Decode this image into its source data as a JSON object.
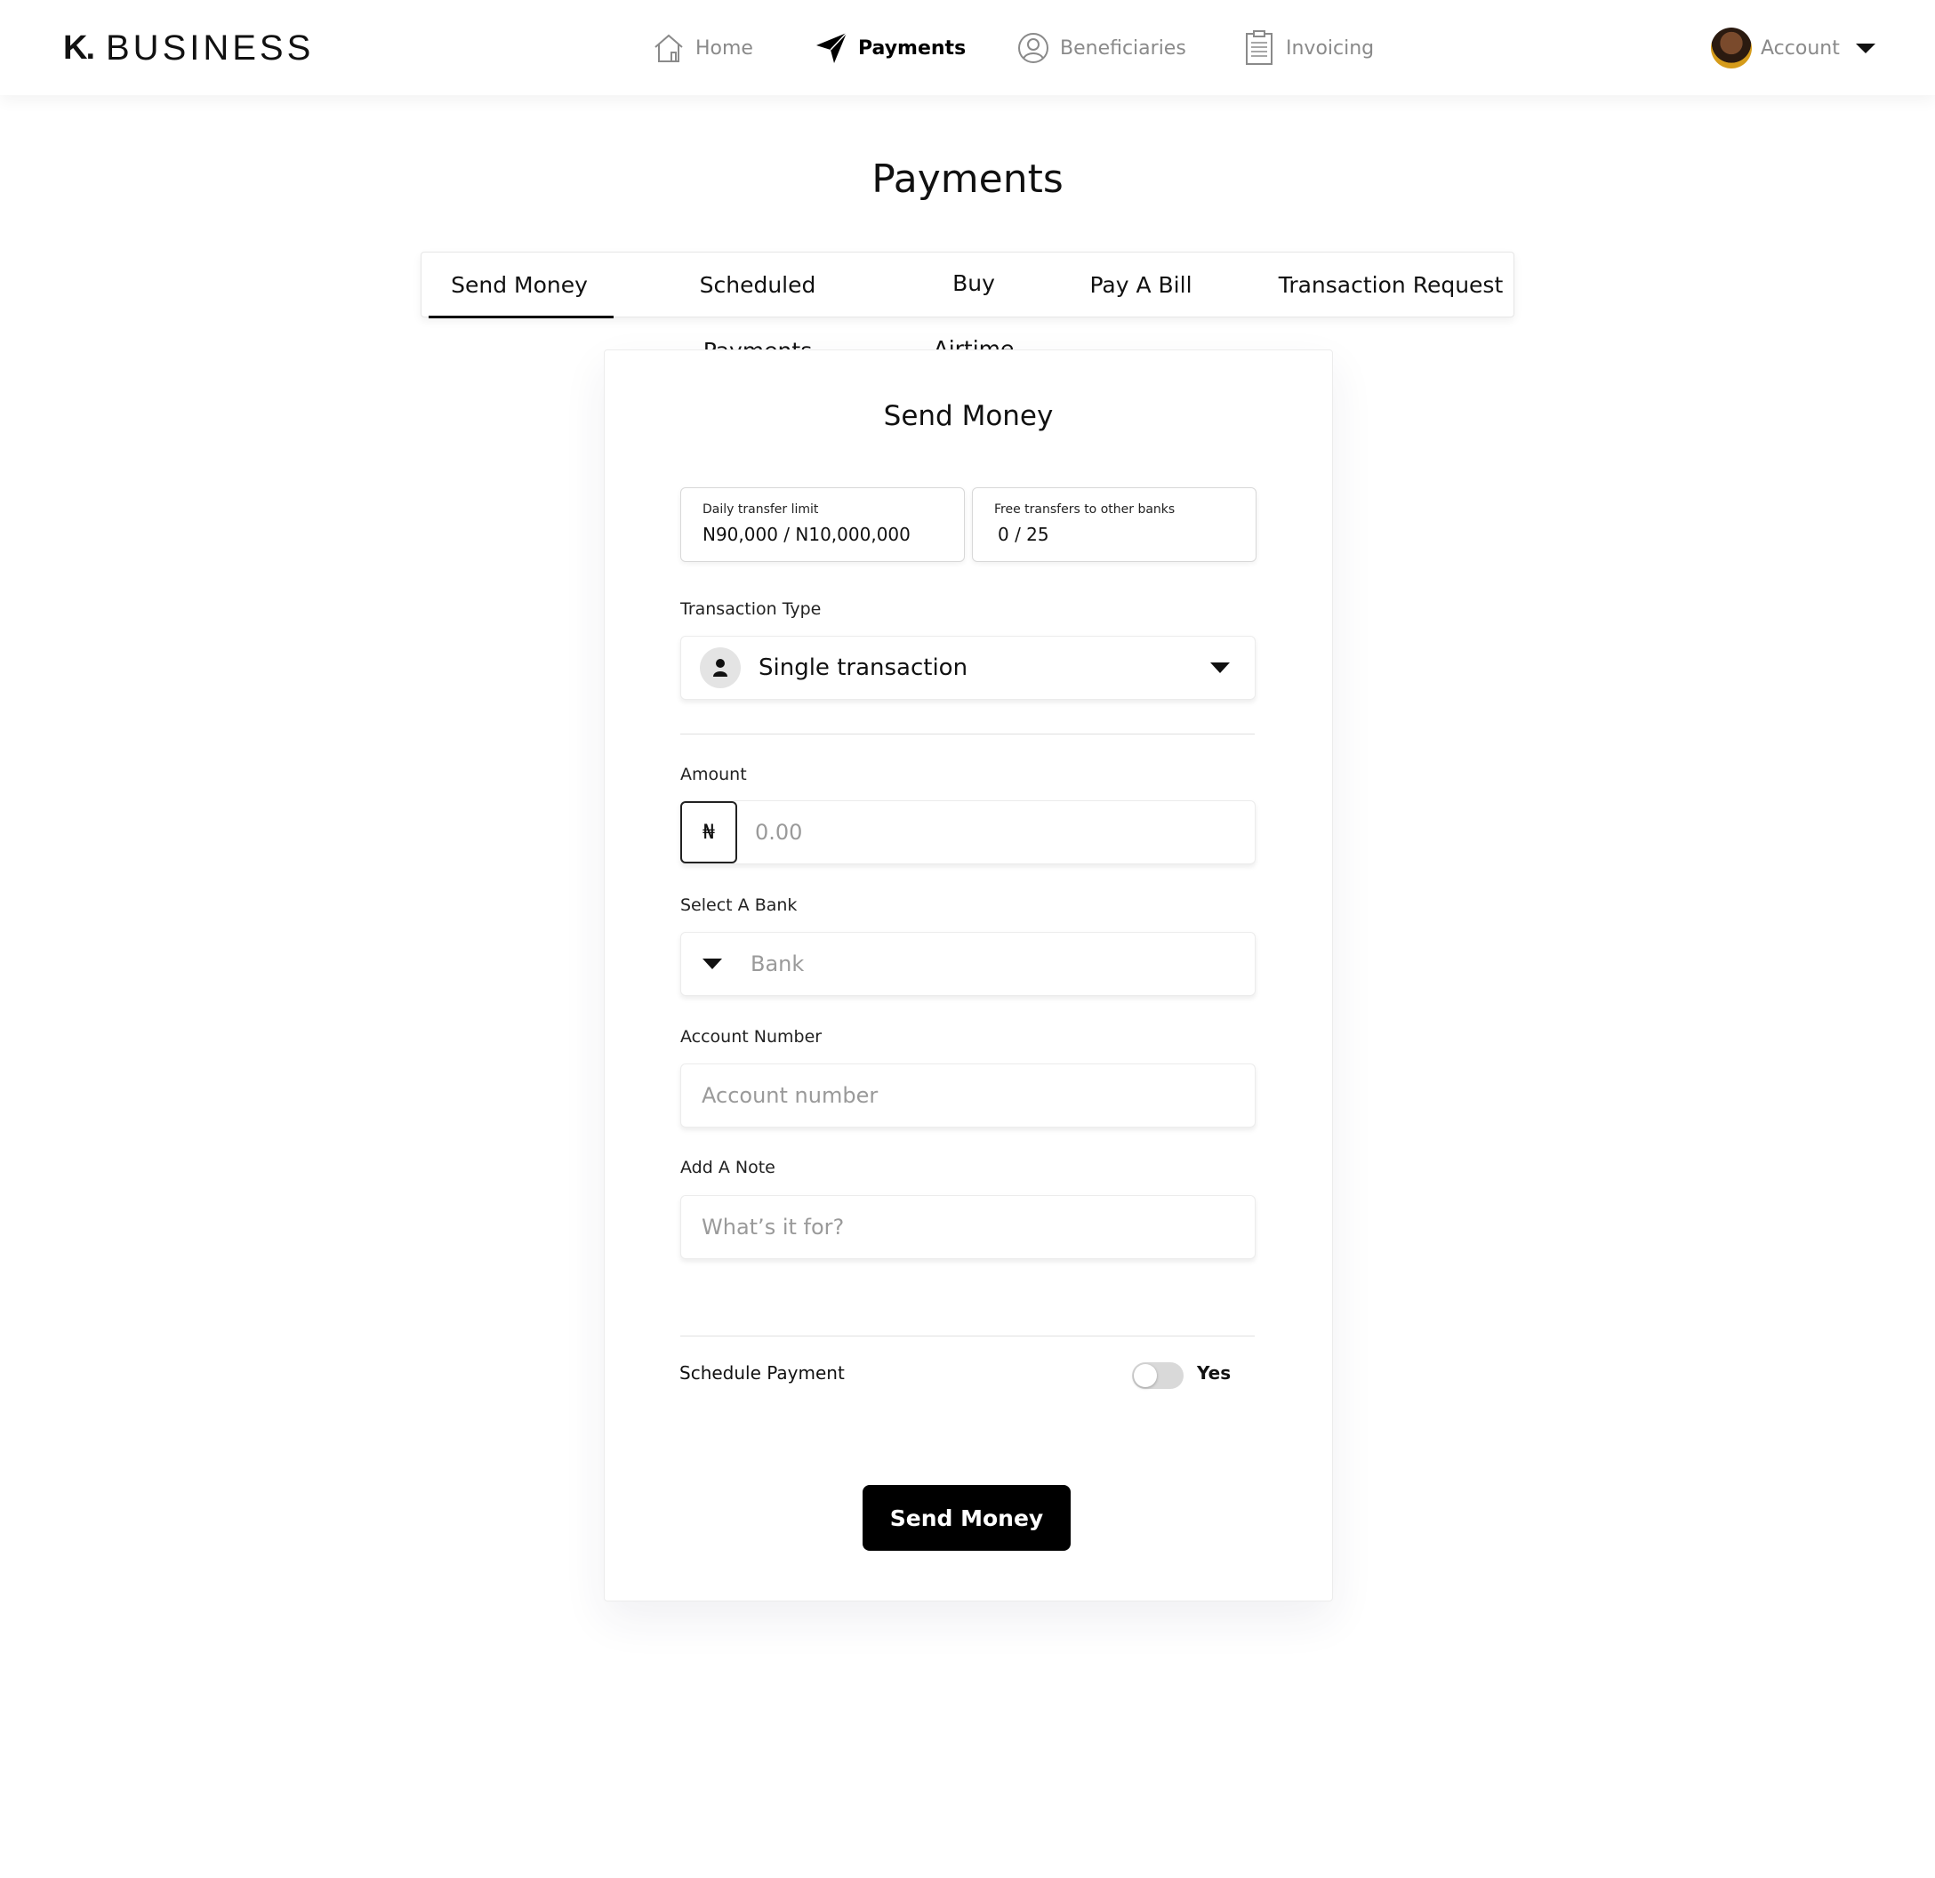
{
  "brand": {
    "mark": "K.",
    "name": "BUSINESS"
  },
  "nav": {
    "home": "Home",
    "payments": "Payments",
    "beneficiaries": "Beneficiaries",
    "invoicing": "Invoicing"
  },
  "account": {
    "label": "Account"
  },
  "page": {
    "title": "Payments"
  },
  "tabs": [
    {
      "label": "Send Money",
      "active": true
    },
    {
      "label": "Scheduled Payments"
    },
    {
      "label": "Buy Airtime"
    },
    {
      "label": "Pay A Bill"
    },
    {
      "label": "Transaction Request"
    }
  ],
  "form": {
    "title": "Send Money",
    "daily_limit": {
      "label": "Daily transfer limit",
      "value": "N90,000 / N10,000,000"
    },
    "free_transfers": {
      "label": "Free transfers to other banks",
      "value": "0 / 25"
    },
    "transaction_type": {
      "label": "Transaction Type",
      "value": "Single transaction"
    },
    "amount": {
      "label": "Amount",
      "currency": "₦",
      "placeholder": "0.00"
    },
    "bank": {
      "label": "Select A Bank",
      "placeholder": "Bank"
    },
    "account_number": {
      "label": "Account Number",
      "placeholder": "Account number"
    },
    "note": {
      "label": "Add A Note",
      "placeholder": "What’s it for?"
    },
    "schedule": {
      "label": "Schedule Payment",
      "toggle_text": "Yes",
      "enabled": false
    },
    "submit_label": "Send Money"
  },
  "colors": {
    "accent": "#000000",
    "muted": "#8a8a8a"
  }
}
